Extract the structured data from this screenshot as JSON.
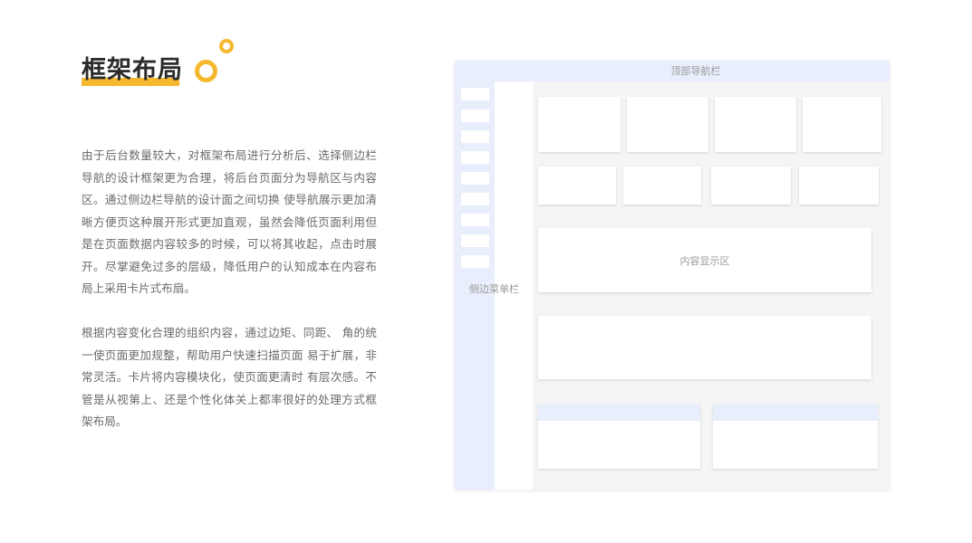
{
  "title": "框架布局",
  "paragraphs": [
    "由于后台数量较大，对框架布局进行分析后、选择侧边栏导航的设计框架更为合理，将后台页面分为导航区与内容区。通过侧边栏导航的设计面之间切换 使导航展示更加清晰方便页这种展开形式更加直观，虽然会降低页面利用但是在页面数据内容较多的时候，可以将其收起，点击时展开。尽掌避免过多的层级，降低用户的认知成本在内容布局上采用卡片式布扇。",
    "根据内容变化合理的组织内容，通过边矩、同距、 角的统一使页面更加规整，帮助用户快速扫描页面 易于扩展，非常灵活。卡片将内容模块化，使页面更清时 有层次感。不管是从视第上、还是个性化体关上都率很好的处理方式框架布局。"
  ],
  "wireframe": {
    "top_nav_label": "顶部导航栏",
    "side_menu_label": "侧边菜单栏",
    "content_area_label": "内容显示区",
    "side_item_count": 9,
    "colors": {
      "accent": "#f5b82e",
      "nav_background": "#e8eefb",
      "canvas_background": "#f5f5f5",
      "card_background": "#ffffff"
    }
  }
}
